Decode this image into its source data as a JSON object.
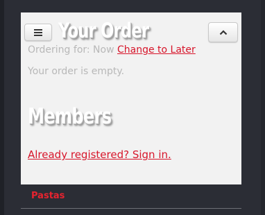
{
  "order": {
    "title": "Your Order",
    "ordering_for_label": "Ordering for: Now",
    "change_link": "Change to Later",
    "empty_message": "Your order is empty."
  },
  "members": {
    "title": "Members",
    "signin_link": "Already registered? Sign in."
  },
  "menu": {
    "categories": [
      {
        "label": "Pastas"
      }
    ]
  },
  "icons": {
    "menu": "hamburger-icon",
    "collapse": "chevron-up-icon"
  },
  "colors": {
    "background": "#2b2d35",
    "panel": "#f2f2f2",
    "accent": "#d7152a",
    "muted_text": "#b8b8b8"
  }
}
